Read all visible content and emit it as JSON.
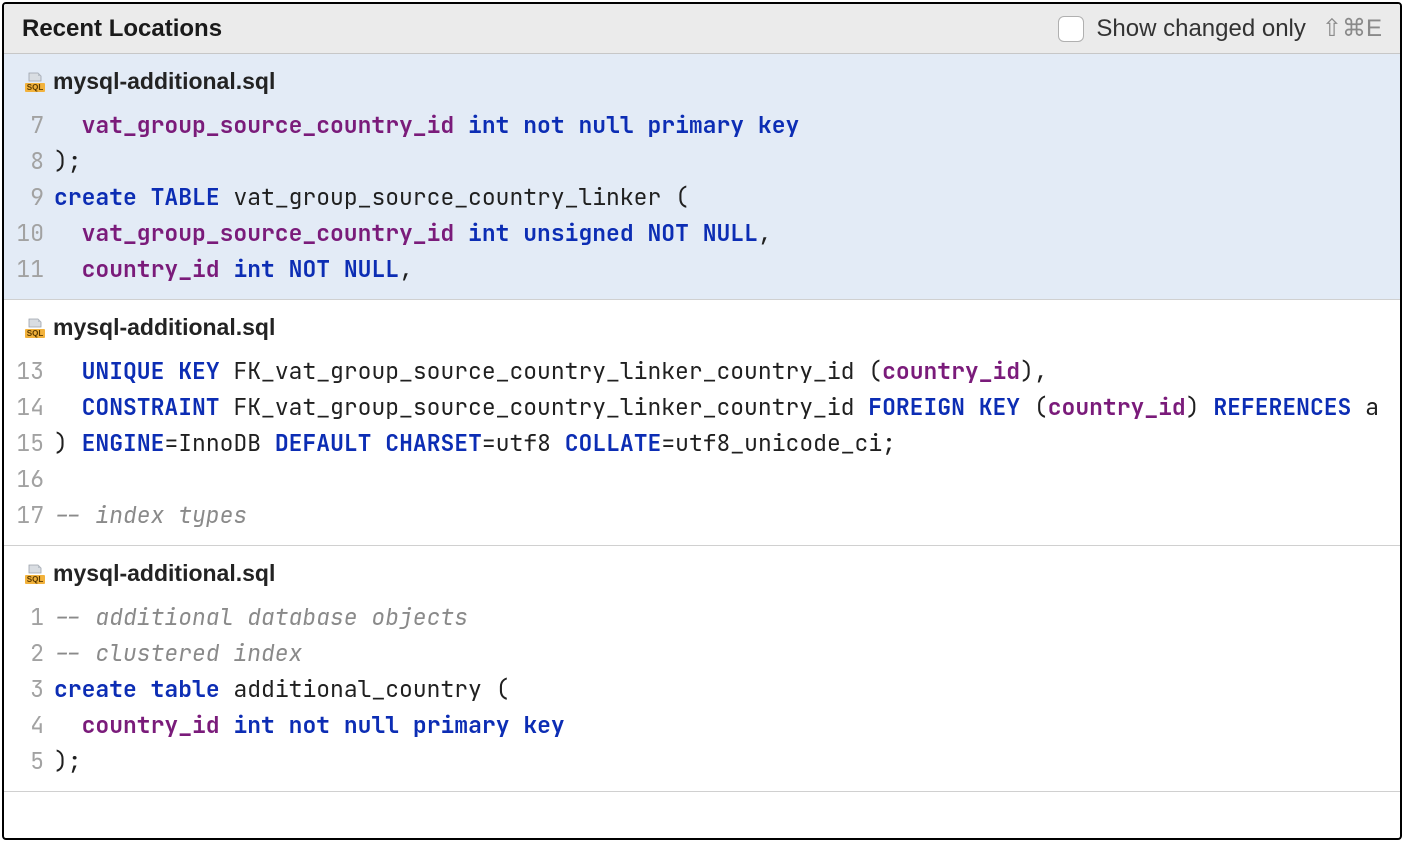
{
  "header": {
    "title": "Recent Locations",
    "show_changed_label": "Show changed only",
    "shortcut": "⇧⌘E"
  },
  "blocks": [
    {
      "file": "mysql-additional.sql",
      "selected": true,
      "lines": [
        {
          "n": 7,
          "tokens": [
            [
              "plain",
              "  "
            ],
            [
              "col",
              "vat_group_source_country_id"
            ],
            [
              "plain",
              " "
            ],
            [
              "kw",
              "int"
            ],
            [
              "plain",
              " "
            ],
            [
              "kw",
              "not"
            ],
            [
              "plain",
              " "
            ],
            [
              "kw",
              "null"
            ],
            [
              "plain",
              " "
            ],
            [
              "kw",
              "primary"
            ],
            [
              "plain",
              " "
            ],
            [
              "kw",
              "key"
            ]
          ]
        },
        {
          "n": 8,
          "tokens": [
            [
              "punc",
              ");"
            ]
          ]
        },
        {
          "n": 9,
          "tokens": [
            [
              "kw",
              "create"
            ],
            [
              "plain",
              " "
            ],
            [
              "kw",
              "TABLE"
            ],
            [
              "plain",
              " "
            ],
            [
              "id",
              "vat_group_source_country_linker"
            ],
            [
              "plain",
              " "
            ],
            [
              "punc",
              "("
            ]
          ]
        },
        {
          "n": 10,
          "tokens": [
            [
              "plain",
              "  "
            ],
            [
              "col",
              "vat_group_source_country_id"
            ],
            [
              "plain",
              " "
            ],
            [
              "kw",
              "int"
            ],
            [
              "plain",
              " "
            ],
            [
              "kw",
              "unsigned"
            ],
            [
              "plain",
              " "
            ],
            [
              "kw",
              "NOT"
            ],
            [
              "plain",
              " "
            ],
            [
              "kw",
              "NULL"
            ],
            [
              "punc",
              ","
            ]
          ]
        },
        {
          "n": 11,
          "tokens": [
            [
              "plain",
              "  "
            ],
            [
              "col",
              "country_id"
            ],
            [
              "plain",
              " "
            ],
            [
              "kw",
              "int"
            ],
            [
              "plain",
              " "
            ],
            [
              "kw",
              "NOT"
            ],
            [
              "plain",
              " "
            ],
            [
              "kw",
              "NULL"
            ],
            [
              "punc",
              ","
            ]
          ]
        }
      ]
    },
    {
      "file": "mysql-additional.sql",
      "selected": false,
      "lines": [
        {
          "n": 13,
          "tokens": [
            [
              "plain",
              "  "
            ],
            [
              "kw",
              "UNIQUE"
            ],
            [
              "plain",
              " "
            ],
            [
              "kw",
              "KEY"
            ],
            [
              "plain",
              " "
            ],
            [
              "id",
              "FK_vat_group_source_country_linker_country_id"
            ],
            [
              "plain",
              " "
            ],
            [
              "punc",
              "("
            ],
            [
              "col",
              "country_id"
            ],
            [
              "punc",
              "),"
            ]
          ]
        },
        {
          "n": 14,
          "tokens": [
            [
              "plain",
              "  "
            ],
            [
              "kw",
              "CONSTRAINT"
            ],
            [
              "plain",
              " "
            ],
            [
              "id",
              "FK_vat_group_source_country_linker_country_id"
            ],
            [
              "plain",
              " "
            ],
            [
              "kw",
              "FOREIGN"
            ],
            [
              "plain",
              " "
            ],
            [
              "kw",
              "KEY"
            ],
            [
              "plain",
              " "
            ],
            [
              "punc",
              "("
            ],
            [
              "col",
              "country_id"
            ],
            [
              "punc",
              ")"
            ],
            [
              "plain",
              " "
            ],
            [
              "kw",
              "REFERENCES"
            ],
            [
              "plain",
              " "
            ],
            [
              "id",
              "a"
            ]
          ]
        },
        {
          "n": 15,
          "tokens": [
            [
              "punc",
              ")"
            ],
            [
              "plain",
              " "
            ],
            [
              "kw",
              "ENGINE"
            ],
            [
              "punc",
              "="
            ],
            [
              "id",
              "InnoDB"
            ],
            [
              "plain",
              " "
            ],
            [
              "kw",
              "DEFAULT"
            ],
            [
              "plain",
              " "
            ],
            [
              "kw",
              "CHARSET"
            ],
            [
              "punc",
              "="
            ],
            [
              "id",
              "utf8"
            ],
            [
              "plain",
              " "
            ],
            [
              "kw",
              "COLLATE"
            ],
            [
              "punc",
              "="
            ],
            [
              "id",
              "utf8_unicode_ci"
            ],
            [
              "punc",
              ";"
            ]
          ]
        },
        {
          "n": 16,
          "tokens": [
            [
              "plain",
              ""
            ]
          ]
        },
        {
          "n": 17,
          "tokens": [
            [
              "cmt",
              "-- index types"
            ]
          ]
        }
      ]
    },
    {
      "file": "mysql-additional.sql",
      "selected": false,
      "lines": [
        {
          "n": 1,
          "tokens": [
            [
              "cmt",
              "-- additional database objects"
            ]
          ]
        },
        {
          "n": 2,
          "tokens": [
            [
              "cmt",
              "-- clustered index"
            ]
          ]
        },
        {
          "n": 3,
          "tokens": [
            [
              "kw",
              "create"
            ],
            [
              "plain",
              " "
            ],
            [
              "kw",
              "table"
            ],
            [
              "plain",
              " "
            ],
            [
              "id",
              "additional_country"
            ],
            [
              "plain",
              " "
            ],
            [
              "punc",
              "("
            ]
          ]
        },
        {
          "n": 4,
          "tokens": [
            [
              "plain",
              "  "
            ],
            [
              "col",
              "country_id"
            ],
            [
              "plain",
              " "
            ],
            [
              "kw",
              "int"
            ],
            [
              "plain",
              " "
            ],
            [
              "kw",
              "not"
            ],
            [
              "plain",
              " "
            ],
            [
              "kw",
              "null"
            ],
            [
              "plain",
              " "
            ],
            [
              "kw",
              "primary"
            ],
            [
              "plain",
              " "
            ],
            [
              "kw",
              "key"
            ]
          ]
        },
        {
          "n": 5,
          "tokens": [
            [
              "punc",
              ");"
            ]
          ]
        }
      ]
    }
  ]
}
